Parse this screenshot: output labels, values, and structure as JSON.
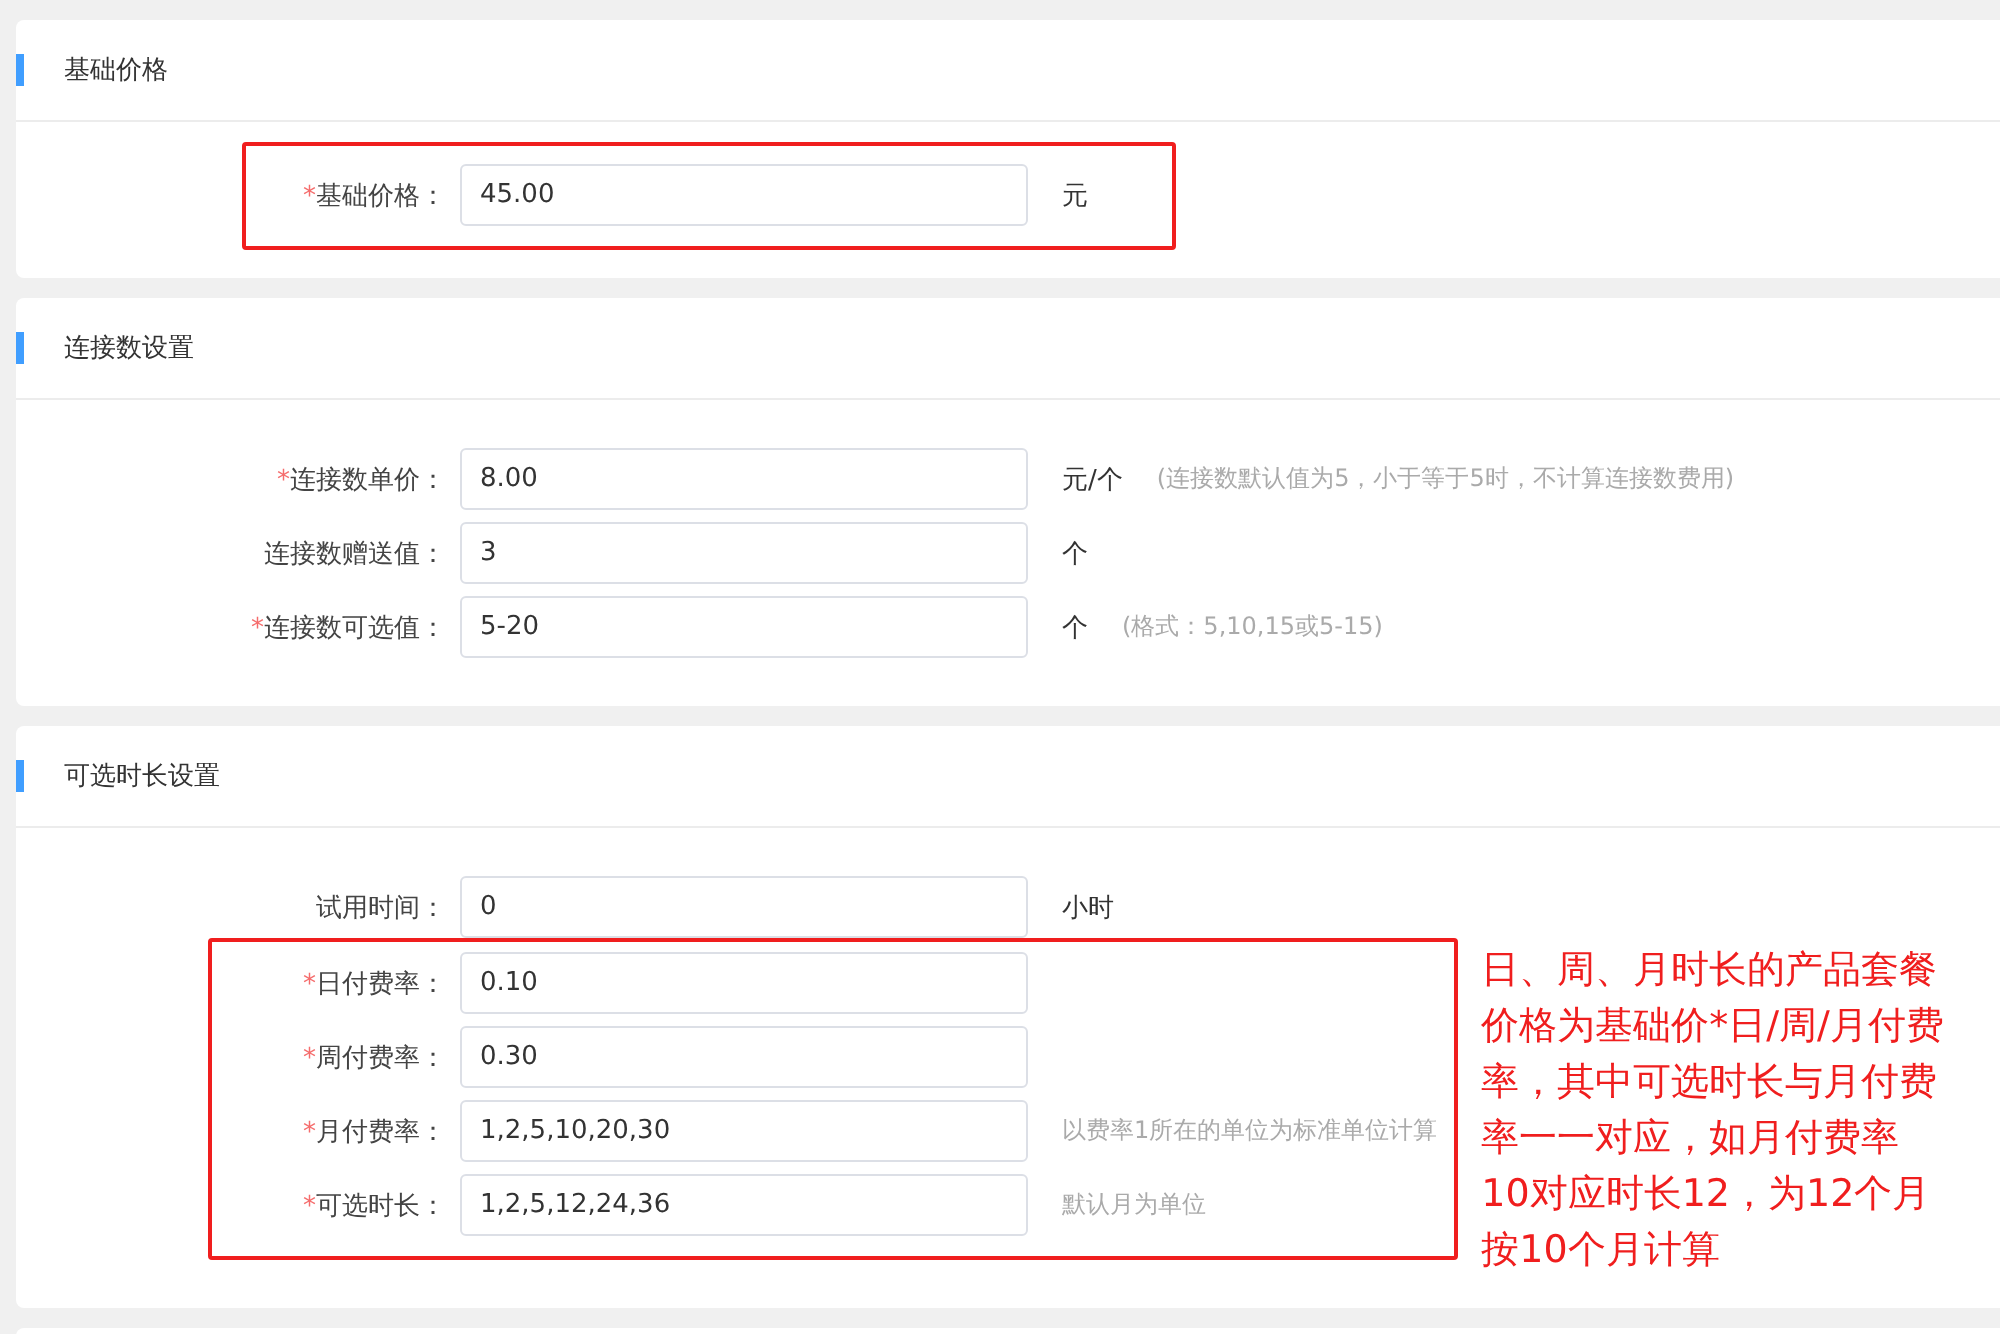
{
  "sections": [
    {
      "title": "基础价格",
      "rows": [
        {
          "mark": "*",
          "label": "基础价格：",
          "value": "45.00",
          "unit": "元",
          "annotated": true
        }
      ]
    },
    {
      "title": "连接数设置",
      "rows": [
        {
          "mark": "*",
          "label": "连接数单价：",
          "value": "8.00",
          "unit": "元/个",
          "hint": "(连接数默认值为5，小于等于5时，不计算连接数费用)",
          "annotated": false
        },
        {
          "label": "连接数赠送值：",
          "value": "3",
          "unit": "个",
          "annotated": false
        },
        {
          "mark": "*",
          "label": "连接数可选值：",
          "value": "5-20",
          "unit": "个",
          "hint": "(格式：5,10,15或5-15)",
          "annotated": false
        }
      ]
    },
    {
      "title": "可选时长设置",
      "rows": [
        {
          "label": "试用时间：",
          "value": "0",
          "unit": "小时",
          "annotated": false
        },
        {
          "mark": "*",
          "label": "日付费率：",
          "value": "0.10",
          "annotated": true
        },
        {
          "mark": "*",
          "label": "周付费率：",
          "value": "0.30",
          "annotated": true
        },
        {
          "mark": "*",
          "label": "月付费率：",
          "value": "1,2,5,10,20,30",
          "hint": "以费率1所在的单位为标准单位计算",
          "annotated": true
        },
        {
          "mark": "*",
          "label": "可选时长：",
          "value": "1,2,5,12,24,36",
          "hint": "默认月为单位",
          "annotated": true
        }
      ],
      "note": "日、周、月时长的产品套餐价格为基础价*日/周/月付费率，其中可选时长与月付费率一一对应，如月付费率10对应时长12，为12个月按10个月计算"
    }
  ]
}
